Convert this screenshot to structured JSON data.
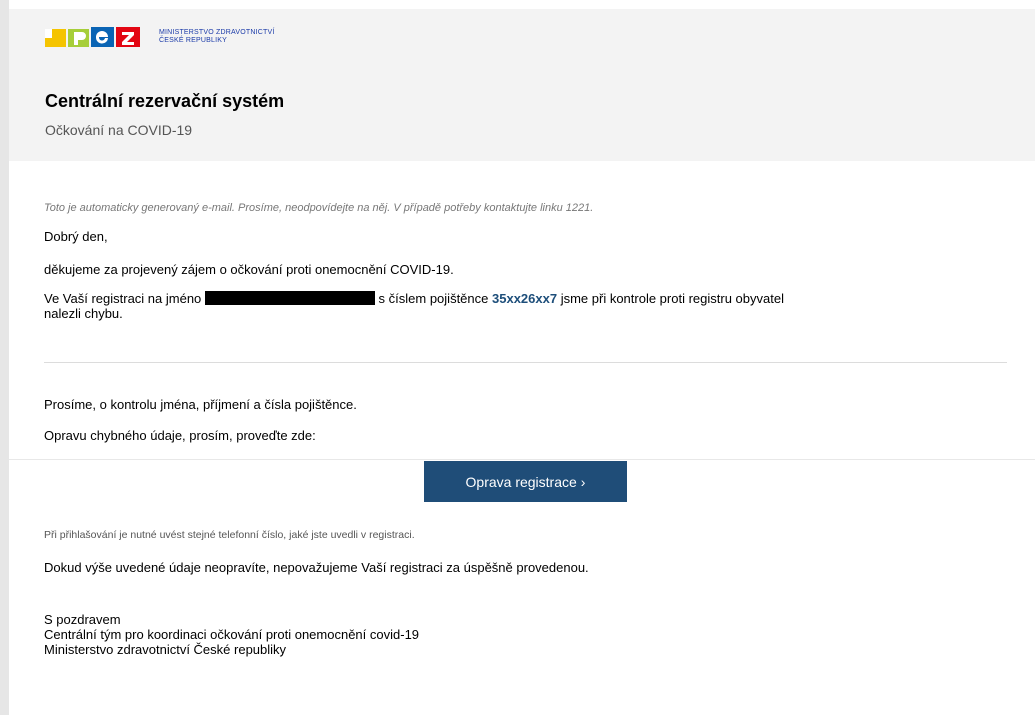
{
  "header": {
    "logo_text": "MZ",
    "ministry_line1": "MINISTERSTVO ZDRAVOTNICTVÍ",
    "ministry_line2": "ČESKÉ REPUBLIKY",
    "title": "Centrální rezervační systém",
    "subtitle": "Očkování na COVID-19"
  },
  "email": {
    "notice": "Toto je automaticky generovaný e-mail. Prosíme, neodpovídejte na něj. V případě potřeby kontaktujte linku 1221.",
    "greeting": "Dobrý den,",
    "thanks": "děkujeme za projevený zájem o očkování proti onemocnění COVID-19.",
    "registration_prefix": "Ve Vaší registraci na jméno",
    "registration_middle": "s číslem pojištěnce",
    "insurance_number": "35xx26xx7",
    "registration_suffix": "jsme při kontrole proti registru obyvatel",
    "registration_line2": "nalezli chybu.",
    "check_request": "Prosíme, o kontrolu jména, příjmení a čísla pojištěnce.",
    "fix_request": "Opravu chybného údaje, prosím, proveďte zde:",
    "button_label": "Oprava registrace",
    "button_chevron": "›",
    "phone_note": "Při přihlašování je nutné uvést stejné telefonní číslo, jaké jste uvedli v registraci.",
    "warning": "Dokud výše uvedené údaje neopravíte, nepovažujeme Vaší registraci za úspěšně provedenou.",
    "sign_1": "S pozdravem",
    "sign_2": "Centrální tým pro koordinaci očkování proti onemocnění covid-19",
    "sign_3": "Ministerstvo zdravotnictví České republiky"
  },
  "colors": {
    "button_bg": "#1f4d78",
    "insurance_number": "#1d4e7a",
    "logo_yellow": "#f5c400",
    "logo_green": "#a6ce39",
    "logo_blue": "#0a64b4",
    "logo_red": "#e30613"
  },
  "icons": [
    "ministry-logo",
    "chevron-right-icon"
  ]
}
